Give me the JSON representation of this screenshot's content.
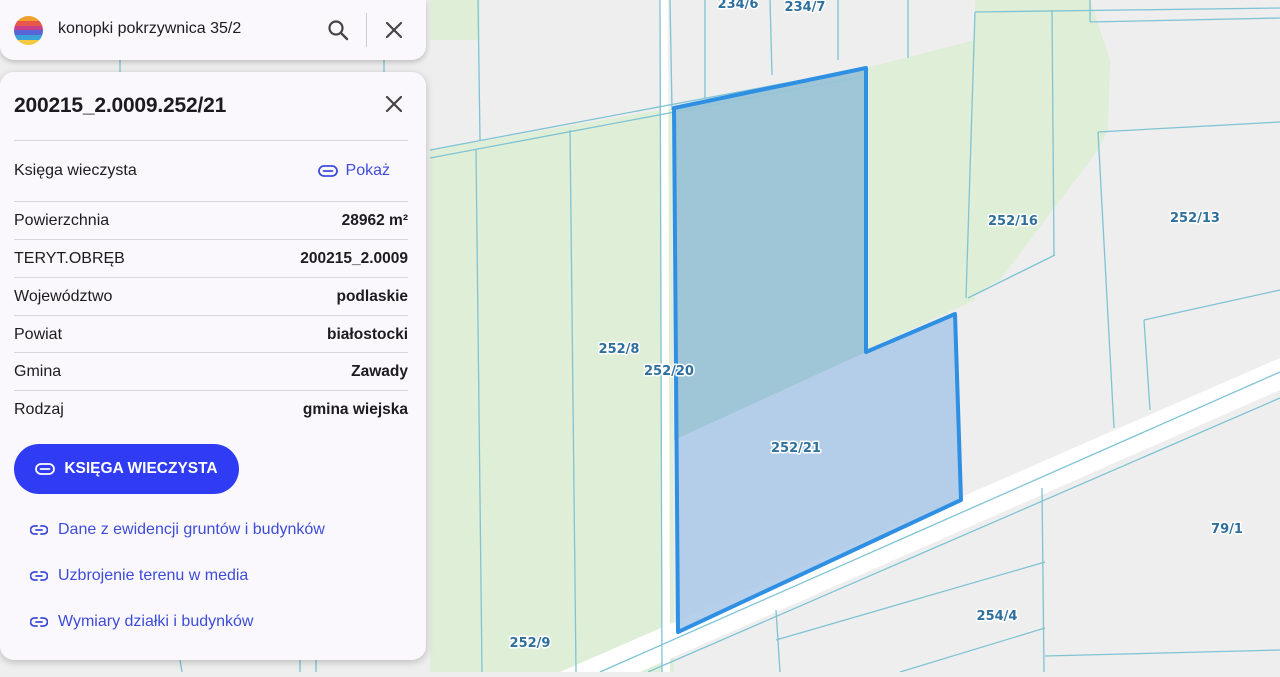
{
  "search": {
    "query": "konopki pokrzywnica 35/2"
  },
  "logo": {
    "stripe_colors": [
      "#f0a02e",
      "#e8574a",
      "#c83f8c",
      "#5865d6",
      "#3aa3d9",
      "#f5c842"
    ]
  },
  "panel": {
    "title": "200215_2.0009.252/21",
    "rows": [
      {
        "label": "Księga wieczysta",
        "value": "Pokaż"
      },
      {
        "label": "Powierzchnia",
        "value": "28962 m²"
      },
      {
        "label": "TERYT.OBRĘB",
        "value": "200215_2.0009"
      },
      {
        "label": "Województwo",
        "value": "podlaskie"
      },
      {
        "label": "Powiat",
        "value": "białostocki"
      },
      {
        "label": "Gmina",
        "value": "Zawady"
      },
      {
        "label": "Rodzaj",
        "value": "gmina wiejska"
      }
    ],
    "primary_button": "KSIĘGA WIECZYSTA",
    "links": [
      "Dane z ewidencji gruntów i budynków",
      "Uzbrojenie terenu w media",
      "Wymiary działki i budynków"
    ]
  },
  "map": {
    "parcel_labels": [
      "234/6",
      "234/7",
      "252/16",
      "252/13",
      "252/8",
      "252/20",
      "252/21",
      "79/1",
      "254/4",
      "252/9"
    ],
    "colors": {
      "background": "#eeeeee",
      "green_area": "#dfeed7",
      "parcel_line": "#7fc3d4",
      "selected_outline": "#2e8fe3",
      "selected_fill": "#a9c8e8",
      "road": "#ffffff",
      "accent": "#2f3cf4"
    }
  }
}
